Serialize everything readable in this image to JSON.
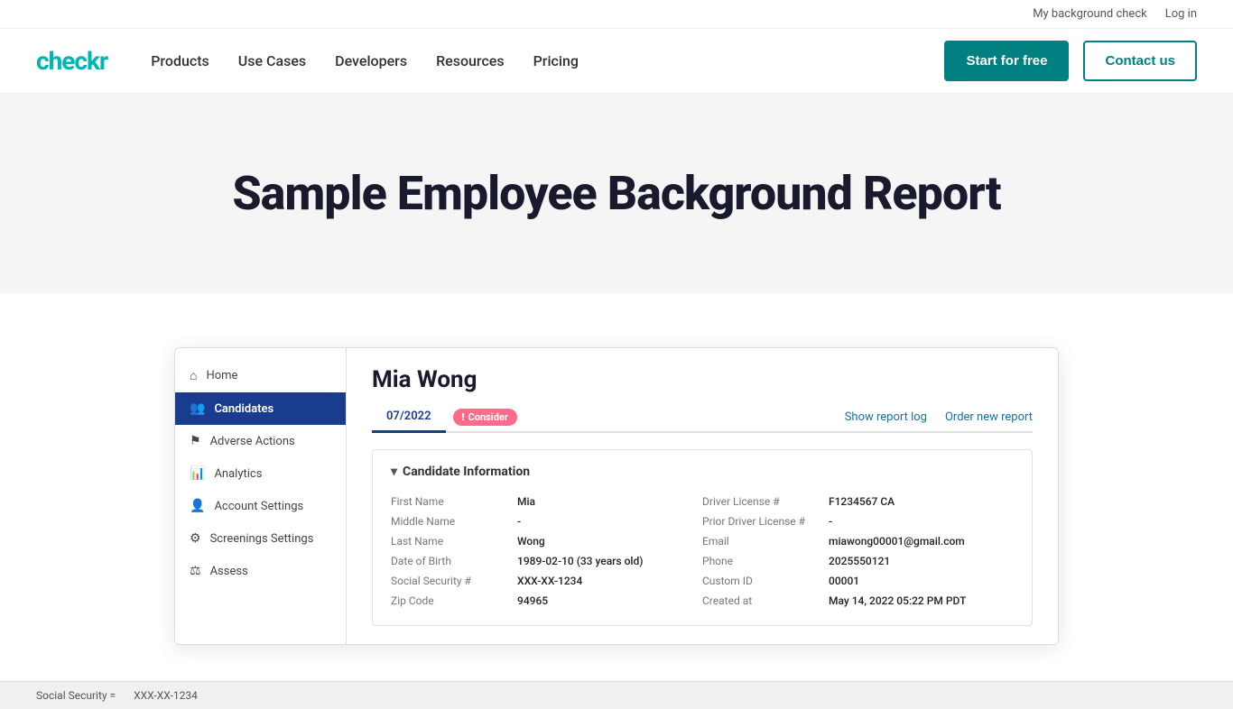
{
  "topbar": {
    "my_background_check": "My background check",
    "log_in": "Log in"
  },
  "nav": {
    "logo": "checkr",
    "links": [
      {
        "label": "Products",
        "id": "products"
      },
      {
        "label": "Use Cases",
        "id": "use-cases"
      },
      {
        "label": "Developers",
        "id": "developers"
      },
      {
        "label": "Resources",
        "id": "resources"
      },
      {
        "label": "Pricing",
        "id": "pricing"
      }
    ],
    "cta_primary": "Start for free",
    "cta_outline": "Contact us"
  },
  "hero": {
    "title": "Sample Employee Background Report"
  },
  "mock_app": {
    "sidebar": {
      "items": [
        {
          "label": "Home",
          "id": "home",
          "icon": "⌂",
          "active": false
        },
        {
          "label": "Candidates",
          "id": "candidates",
          "icon": "👥",
          "active": true
        },
        {
          "label": "Adverse Actions",
          "id": "adverse-actions",
          "icon": "⚑",
          "active": false
        },
        {
          "label": "Analytics",
          "id": "analytics",
          "icon": "📊",
          "active": false
        },
        {
          "label": "Account Settings",
          "id": "account-settings",
          "icon": "👤",
          "active": false
        },
        {
          "label": "Screenings Settings",
          "id": "screenings-settings",
          "icon": "⚙",
          "active": false
        },
        {
          "label": "Assess",
          "id": "assess",
          "icon": "⚖",
          "active": false
        }
      ]
    },
    "main": {
      "candidate_name": "Mia Wong",
      "tab_label": "07/2022",
      "status_badge": "Consider",
      "show_report_log": "Show report log",
      "order_new_report": "Order new report",
      "info_section_title": "Candidate Information",
      "fields_left": [
        {
          "label": "First Name",
          "value": "Mia"
        },
        {
          "label": "Middle Name",
          "value": "-"
        },
        {
          "label": "Last Name",
          "value": "Wong"
        },
        {
          "label": "Date of Birth",
          "value": "1989-02-10 (33 years old)"
        },
        {
          "label": "Social Security #",
          "value": "XXX-XX-1234"
        },
        {
          "label": "Zip Code",
          "value": "94965"
        }
      ],
      "fields_right": [
        {
          "label": "Driver License #",
          "value": "F1234567 CA"
        },
        {
          "label": "Prior Driver License #",
          "value": "-"
        },
        {
          "label": "Email",
          "value": "miawong00001@gmail.com"
        },
        {
          "label": "Phone",
          "value": "2025550121"
        },
        {
          "label": "Custom ID",
          "value": "00001"
        },
        {
          "label": "Created at",
          "value": "May 14, 2022 05:22 PM PDT"
        }
      ]
    }
  },
  "bottom_bar": {
    "social_security_label": "Social Security =",
    "social_security_value": "XXX-XX-1234"
  }
}
